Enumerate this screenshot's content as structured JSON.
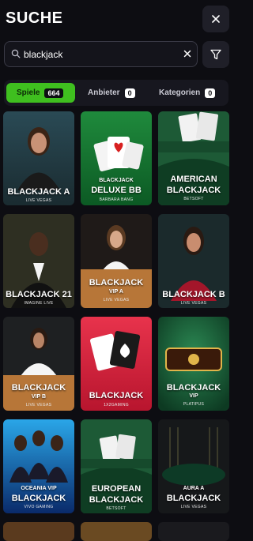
{
  "header": {
    "title": "SUCHE"
  },
  "search": {
    "value": "blackjack"
  },
  "tabs": [
    {
      "label": "Spiele",
      "count": "664"
    },
    {
      "label": "Anbieter",
      "count": "0"
    },
    {
      "label": "Kategorien",
      "count": "0"
    }
  ],
  "games": [
    {
      "title_line1": "BLACKJACK A",
      "title_line2": "",
      "provider": "LIVE VEGAS"
    },
    {
      "title_line1": "BLACKJACK",
      "title_line2": "DELUXE BB",
      "provider": "BARBARA BANG"
    },
    {
      "title_line1": "AMERICAN",
      "title_line2": "BLACKJACK",
      "provider": "BETSOFT"
    },
    {
      "title_line1": "BLACKJACK 21",
      "title_line2": "",
      "provider": "IMAGINE LIVE"
    },
    {
      "title_line1": "BLACKJACK",
      "title_line2": "VIP A",
      "provider": "LIVE VEGAS"
    },
    {
      "title_line1": "BLACKJACK B",
      "title_line2": "",
      "provider": "LIVE VEGAS"
    },
    {
      "title_line1": "BLACKJACK",
      "title_line2": "VIP B",
      "provider": "LIVE VEGAS"
    },
    {
      "title_line1": "BLACKJACK",
      "title_line2": "",
      "provider": "1X2GAMING"
    },
    {
      "title_line1": "BLACKJACK",
      "title_line2": "VIP",
      "provider": "PLATIPUS"
    },
    {
      "title_line1": "OCEANIA VIP",
      "title_line2": "BLACKJACK",
      "provider": "VIVO GAMING"
    },
    {
      "title_line1": "EUROPEAN",
      "title_line2": "BLACKJACK",
      "provider": "BETSOFT"
    },
    {
      "title_line1": "AURA A",
      "title_line2": "BLACKJACK",
      "provider": "LIVE VEGAS"
    }
  ],
  "icons": {
    "close": "close-icon",
    "search": "search-icon",
    "clear": "clear-icon",
    "filter": "filter-icon"
  },
  "colors": {
    "accent": "#3fbf1f",
    "background": "#0d0d12"
  }
}
